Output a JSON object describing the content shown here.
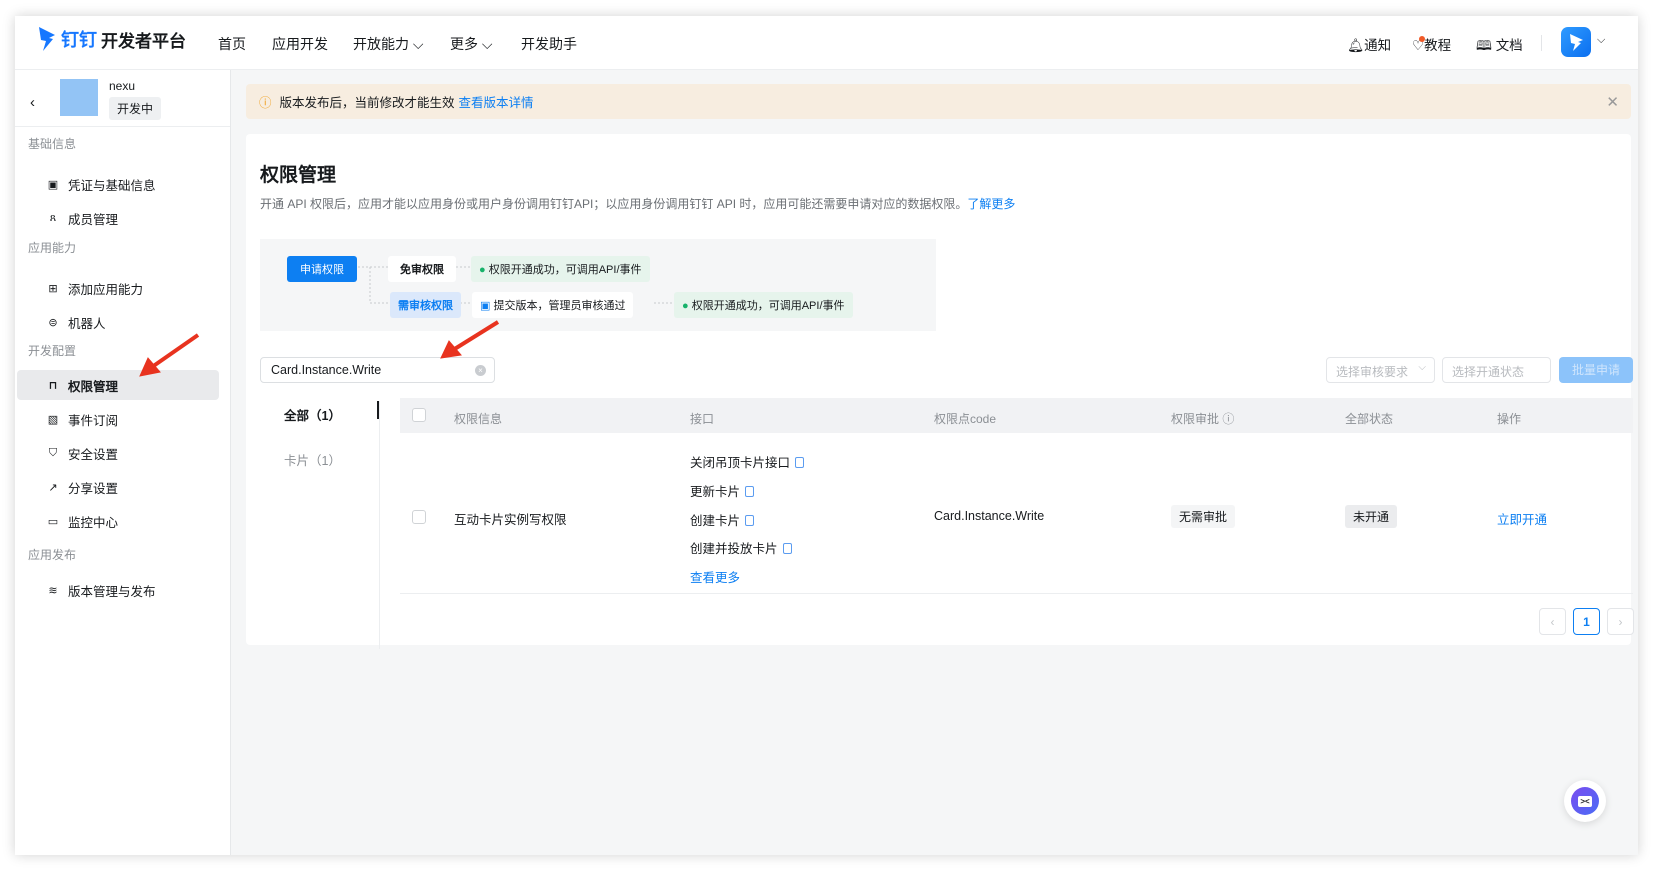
{
  "header": {
    "brand": "钉钉",
    "brand_suffix": "开发者平台",
    "nav": [
      {
        "label": "首页"
      },
      {
        "label": "应用开发"
      },
      {
        "label": "开放能力",
        "has_dropdown": true
      },
      {
        "label": "更多",
        "has_dropdown": true
      },
      {
        "label": "开发助手"
      }
    ],
    "right": [
      {
        "label": "通知",
        "icon": "bell-icon"
      },
      {
        "label": "教程",
        "icon": "bulb-icon",
        "badge_dot": true
      },
      {
        "label": "文档",
        "icon": "book-icon"
      }
    ]
  },
  "app": {
    "name": "nexu",
    "status": "开发中"
  },
  "sidebar": {
    "sections": [
      {
        "label": "基础信息",
        "items": [
          {
            "label": "凭证与基础信息",
            "icon": "credential-icon"
          },
          {
            "label": "成员管理",
            "icon": "user-icon"
          }
        ]
      },
      {
        "label": "应用能力",
        "items": [
          {
            "label": "添加应用能力",
            "icon": "apps-add-icon"
          },
          {
            "label": "机器人",
            "icon": "robot-icon"
          }
        ]
      },
      {
        "label": "开发配置",
        "items": [
          {
            "label": "权限管理",
            "icon": "lock-icon",
            "active": true
          },
          {
            "label": "事件订阅",
            "icon": "rss-icon"
          },
          {
            "label": "安全设置",
            "icon": "shield-icon"
          },
          {
            "label": "分享设置",
            "icon": "share-icon"
          },
          {
            "label": "监控中心",
            "icon": "monitor-icon"
          }
        ]
      },
      {
        "label": "应用发布",
        "items": [
          {
            "label": "版本管理与发布",
            "icon": "layers-icon"
          }
        ]
      }
    ]
  },
  "alert": {
    "text": "版本发布后，当前修改才能生效",
    "link": "查看版本详情"
  },
  "page": {
    "title": "权限管理",
    "description": "开通 API 权限后，应用才能以应用身份或用户身份调用钉钉API；以应用身份调用钉钉 API 时，应用可能还需要申请对应的数据权限。",
    "learn_more": "了解更多"
  },
  "flow": {
    "apply": "申请权限",
    "free": "免审权限",
    "free_result": "权限开通成功，可调用API/事件",
    "review": "需审核权限",
    "review_step": "提交版本，管理员审核通过",
    "review_result": "权限开通成功，可调用API/事件"
  },
  "filters": {
    "search_value": "Card.Instance.Write",
    "review_placeholder": "选择审核要求",
    "status_placeholder": "选择开通状态",
    "batch_apply": "批量申请"
  },
  "tabs": [
    {
      "label": "全部（1）",
      "active": true
    },
    {
      "label": "卡片（1）"
    }
  ],
  "table": {
    "columns": [
      "权限信息",
      "接口",
      "权限点code",
      "权限审批",
      "全部状态",
      "操作"
    ],
    "rows": [
      {
        "name": "互动卡片实例写权限",
        "apis": [
          "关闭吊顶卡片接口",
          "更新卡片",
          "创建卡片",
          "创建并投放卡片"
        ],
        "more": "查看更多",
        "code": "Card.Instance.Write",
        "approval": "无需审批",
        "status": "未开通",
        "action": "立即开通"
      }
    ]
  },
  "pagination": {
    "current": "1"
  },
  "colors": {
    "accent": "#0d7ff2",
    "alert_bg": "#f7ede0",
    "success_bg": "#e6f4ec",
    "annotation_arrow": "#e8331f"
  }
}
